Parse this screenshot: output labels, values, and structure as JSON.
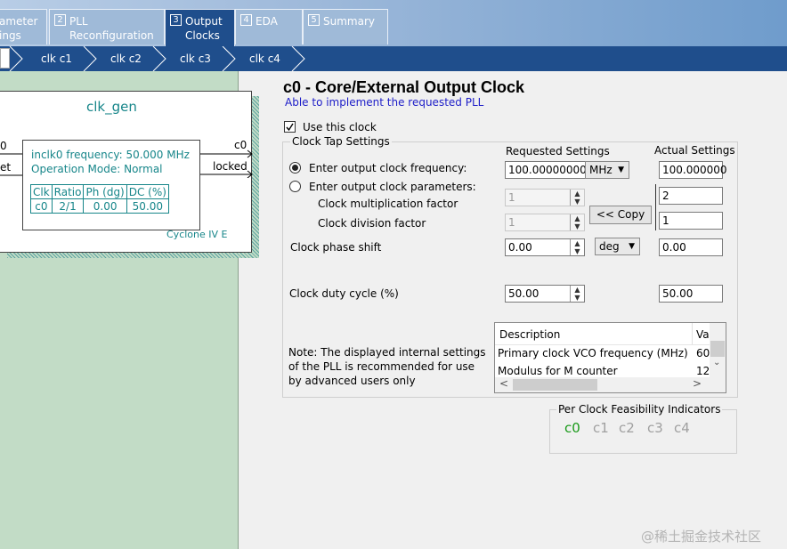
{
  "tabs": [
    {
      "num": "",
      "label": "ameter\nings"
    },
    {
      "num": "2",
      "label": "PLL\nReconfiguration"
    },
    {
      "num": "3",
      "label": "Output\nClocks"
    },
    {
      "num": "4",
      "label": "EDA"
    },
    {
      "num": "5",
      "label": "Summary"
    }
  ],
  "clock_tabs": [
    "clk c1",
    "clk c2",
    "clk c3",
    "clk c4"
  ],
  "symbol": {
    "title": "clk_gen",
    "left_pin_1": "0",
    "left_pin_2": "et",
    "out_c0": "c0",
    "out_locked": "locked",
    "info_freq": "inclk0 frequency: 50.000 MHz",
    "info_mode": "Operation Mode: Normal",
    "table_headers": [
      "Clk",
      "Ratio",
      "Ph (dg)",
      "DC (%)"
    ],
    "table_row": [
      "c0",
      "2/1",
      "0.00",
      "50.00"
    ],
    "device": "Cyclone IV E"
  },
  "page": {
    "title": "c0 - Core/External Output Clock",
    "status": "Able to implement the requested PLL",
    "use_clock_label": "Use this clock",
    "use_clock_checked": true,
    "group_title": "Clock Tap Settings",
    "requested_header": "Requested Settings",
    "actual_header": "Actual Settings",
    "radio_freq_label": "Enter output clock frequency:",
    "radio_params_label": "Enter output clock parameters:",
    "mult_label": "Clock multiplication factor",
    "div_label": "Clock division factor",
    "phase_label": "Clock phase shift",
    "duty_label": "Clock duty cycle (%)",
    "freq_value": "100.00000000",
    "freq_unit": "MHz",
    "actual_freq": "100.000000",
    "mult_value": "1",
    "div_value": "1",
    "actual_mult": "2",
    "actual_div": "1",
    "copy_button": "<< Copy",
    "phase_value": "0.00",
    "phase_unit": "deg",
    "actual_phase": "0.00",
    "duty_value": "50.00",
    "actual_duty": "50.00",
    "note": "Note: The displayed internal settings of the PLL is recommended for use by advanced users only",
    "table_col_desc": "Description",
    "table_col_val": "Va",
    "table_rows": [
      {
        "desc": "Primary clock VCO frequency (MHz)",
        "val": "60"
      },
      {
        "desc": "Modulus for M counter",
        "val": "12"
      }
    ],
    "feasibility_title": "Per Clock Feasibility Indicators",
    "feasibility": [
      "c0",
      "c1",
      "c2",
      "c3",
      "c4"
    ]
  },
  "colors": {
    "active_tab": "#1f4e8c",
    "left_panel": "#c2dcc6",
    "symbol_text": "#17868a",
    "status_text": "#1c1cc8",
    "feasible": "#1a9a1a",
    "infeasible": "#a0a0a0"
  },
  "watermark": "@稀土掘金技术社区"
}
